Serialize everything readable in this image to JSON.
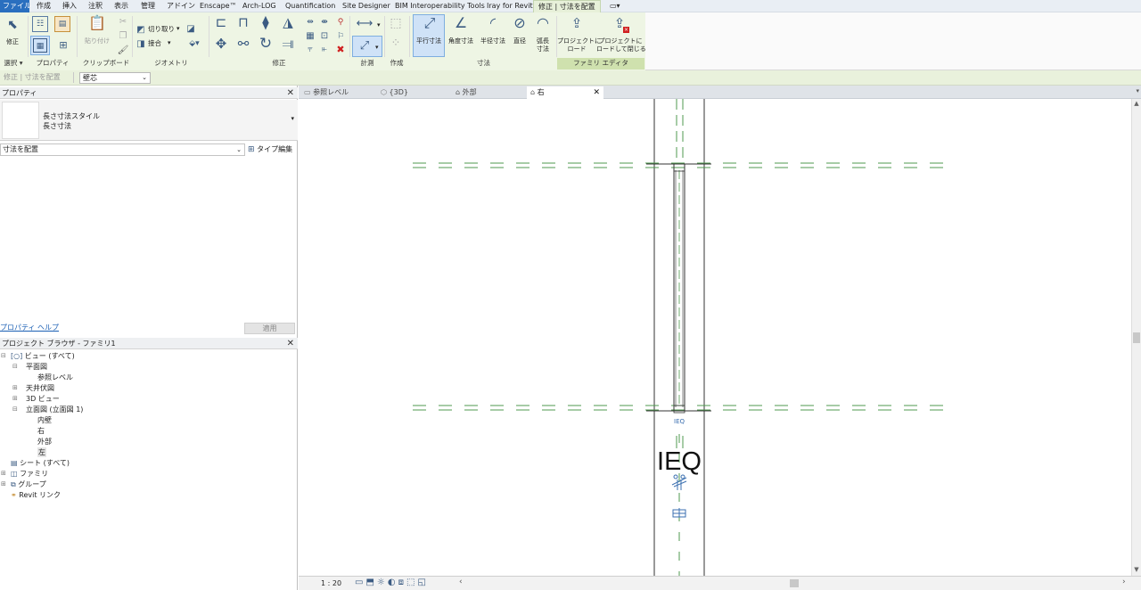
{
  "menu": {
    "tabs": [
      "ファイル",
      "作成",
      "挿入",
      "注釈",
      "表示",
      "管理",
      "アドイン",
      "Enscape™",
      "Arch-LOG",
      "Quantification",
      "Site Designer",
      "BIM Interoperability Tools",
      "Iray for Revit",
      "修正 | 寸法を配置"
    ],
    "extra_icon": "window-dropdown-icon"
  },
  "ribbon": {
    "select": {
      "modify_label": "修正",
      "panel_label": "選択 ▾"
    },
    "properties": {
      "panel_label": "プロパティ"
    },
    "clipboard": {
      "paste_label": "貼り付け",
      "panel_label": "クリップボード"
    },
    "geometry": {
      "cut_label": "切り取り",
      "join_label": "接合",
      "panel_label": "ジオメトリ"
    },
    "modify": {
      "panel_label": "修正"
    },
    "measure": {
      "panel_label": "計測"
    },
    "create": {
      "panel_label": "作成"
    },
    "dimension": {
      "aligned_label": "平行寸法",
      "angular_label": "角度寸法",
      "radial_label": "半径寸法",
      "diameter_label": "直径",
      "arc_line1": "弧長",
      "arc_line2": "寸法",
      "panel_label": "寸法"
    },
    "family_editor": {
      "load_line1": "プロジェクトに",
      "load_line2": "ロード",
      "load_close_line1": "プロジェクトに",
      "load_close_line2": "ロードして閉じる",
      "panel_label": "ファミリ エディタ"
    }
  },
  "options_bar": {
    "context_label": "修正 | 寸法を配置",
    "dropdown_value": "壁芯"
  },
  "properties_panel": {
    "title": "プロパティ",
    "type_line1": "長さ寸法スタイル",
    "type_line2": "長さ寸法",
    "instance_selector": "寸法を配置",
    "edit_type_label": "タイプ編集",
    "help_link": "プロパティ ヘルプ",
    "apply_button": "適用"
  },
  "project_browser": {
    "title": "プロジェクト ブラウザ - ファミリ1",
    "items": {
      "views_all": "ビュー (すべて)",
      "floor_plans": "平面図",
      "ref_level": "参照レベル",
      "ceiling_plans": "天井伏図",
      "views_3d": "3D ビュー",
      "elevations": "立面図 (立面図 1)",
      "interior": "内壁",
      "right": "右",
      "exterior": "外部",
      "left": "左",
      "sheets": "シート (すべて)",
      "families": "ファミリ",
      "groups": "グループ",
      "revit_links": "Revit リンク"
    }
  },
  "view_tabs": [
    "参照レベル",
    "{3D}",
    "外部",
    "右"
  ],
  "canvas": {
    "annotation_small": "IEQ",
    "annotation_large": "IEQ"
  },
  "status": {
    "scale": "1 : 20"
  },
  "colors": {
    "accent": "#2a6fbf",
    "ribbon_tint": "#eef5e4",
    "ref_plane": "#4f9a4f",
    "family_band": "#cfe1ae"
  }
}
